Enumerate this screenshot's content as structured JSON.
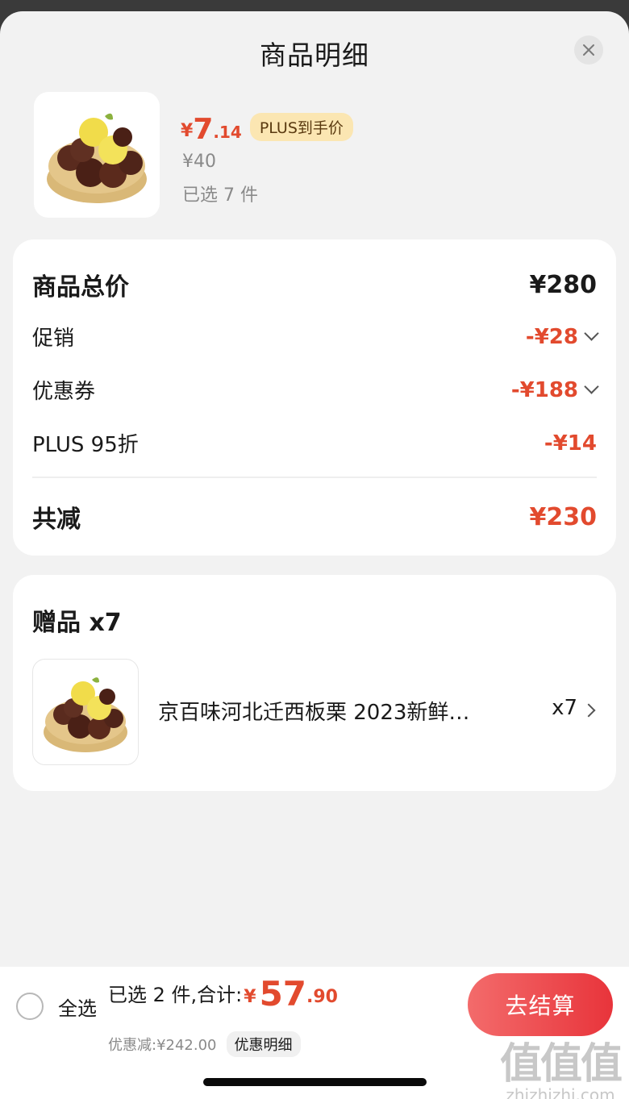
{
  "sheet": {
    "title": "商品明细"
  },
  "product": {
    "price_symbol": "¥",
    "price_int": "7",
    "price_dec": ".14",
    "plus_badge": "PLUS到手价",
    "original_price": "¥40",
    "selected": "已选 7 件"
  },
  "summary": {
    "total_label": "商品总价",
    "total_value": "¥280",
    "promo_label": "促销",
    "promo_value": "-¥28",
    "coupon_label": "优惠券",
    "coupon_value": "-¥188",
    "plus_label": "PLUS 95折",
    "plus_value": "-¥14",
    "reduce_label": "共减",
    "reduce_value": "¥230"
  },
  "gift": {
    "title": "赠品 x7",
    "name": "京百味河北迁西板栗 2023新鲜…",
    "qty": "x7"
  },
  "bottom": {
    "select_all": "全选",
    "total_label": "已选 2 件,合计:",
    "total_symbol": "¥",
    "total_int": "57",
    "total_dec": ".90",
    "discount": "优惠减:¥242.00",
    "discount_detail": "优惠明细",
    "checkout": "去结算"
  },
  "watermark": {
    "glyphs": "值值值",
    "url": "zhizhizhi.com"
  },
  "colors": {
    "accent": "#e24a2e",
    "checkout_start": "#f36b6b",
    "checkout_end": "#e8343b",
    "badge": "#fbe6b2"
  }
}
